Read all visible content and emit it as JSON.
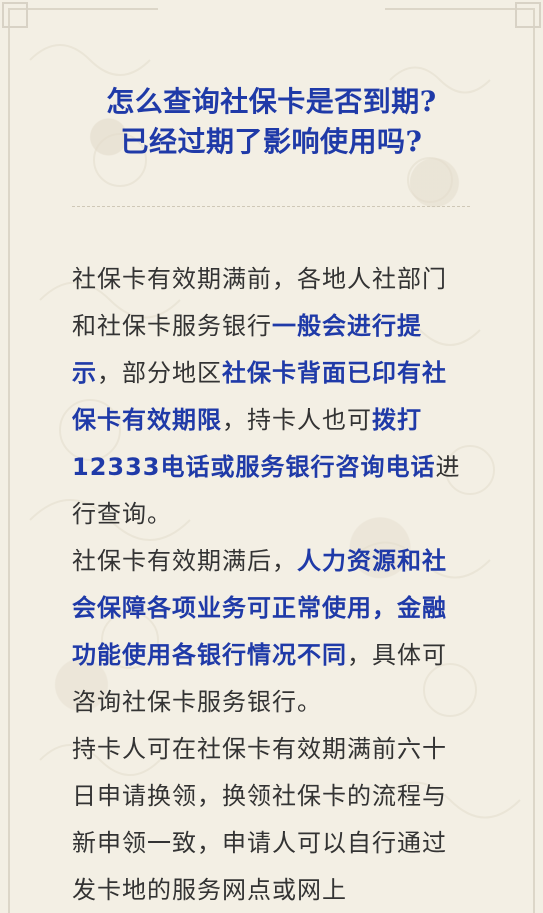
{
  "title": {
    "line1": "怎么查询社保卡是否到期?",
    "line2": "已经过期了影响使用吗?"
  },
  "paragraphs": [
    {
      "segments": [
        {
          "text": "社保卡有效期满前，各地人社部门和社保卡服务银行",
          "bold": false
        },
        {
          "text": "一般会进行提示",
          "bold": true
        },
        {
          "text": "，部分地区",
          "bold": false
        },
        {
          "text": "社保卡背面已印有社保卡有效期限",
          "bold": true
        },
        {
          "text": "，持卡人也可",
          "bold": false
        },
        {
          "text": "拨打12333电话或服务银行咨询电话",
          "bold": true
        },
        {
          "text": "进行查询。",
          "bold": false
        }
      ]
    },
    {
      "segments": [
        {
          "text": "社保卡有效期满后，",
          "bold": false
        },
        {
          "text": "人力资源和社会保障各项业务可正常使用，金融功能使用各银行情况不同",
          "bold": true
        },
        {
          "text": "，具体可咨询社保卡服务银行。",
          "bold": false
        }
      ]
    },
    {
      "segments": [
        {
          "text": "持卡人可在社保卡有效期满前六十日申请换领，换领社保卡的流程与新申领一致，申请人可以自行通过发卡地的服务网点或网上",
          "bold": false
        }
      ]
    }
  ],
  "colors": {
    "accent": "#1f3aa8",
    "text": "#333333",
    "background": "#f3efe4"
  }
}
